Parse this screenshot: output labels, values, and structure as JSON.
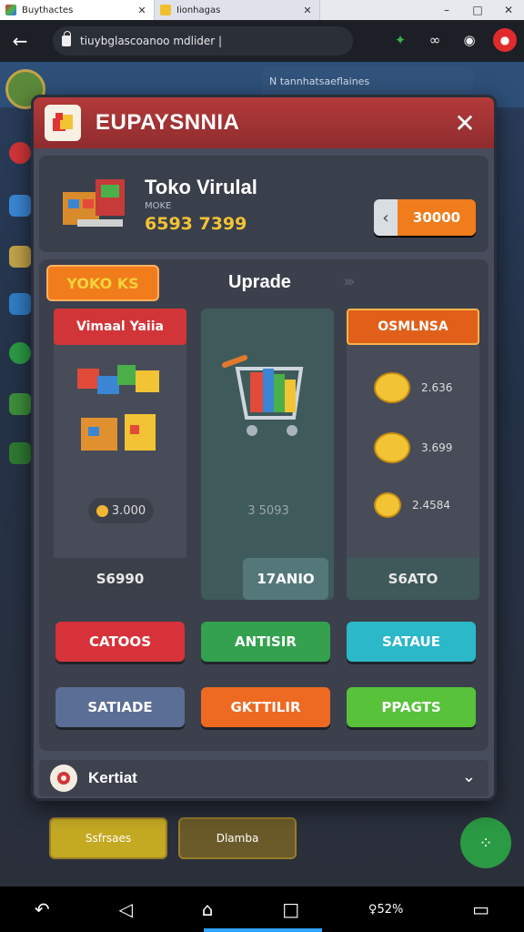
{
  "browser": {
    "active_tab": "Buythactes",
    "inactive_tab": "Iionhagas",
    "address": "tiuybglascoanoo mdlider |",
    "window_controls": [
      "–",
      "□",
      "✕"
    ]
  },
  "background": {
    "top_pill": "N tannhatsaeflaines",
    "bottom_buttons": [
      "Ssfrsaes",
      "Dlamba"
    ]
  },
  "modal": {
    "title": "EUPAYSNNIA",
    "store": {
      "name": "Toko Virulal",
      "subtitle": "MOKE",
      "number": "6593 7399",
      "price": "30000"
    },
    "panel": {
      "tag": "YOKO KS",
      "title": "Uprade",
      "columns": [
        {
          "header": "Vimaal Yaiia",
          "amount": "3.000",
          "footer": "S6990"
        },
        {
          "header": "",
          "amount": "3 5093",
          "footer": "17ANIO"
        },
        {
          "header": "OSMLNSA",
          "amount": "",
          "footer": "S6ATO",
          "coins": [
            "2.636",
            "3.699",
            "2.4584"
          ]
        }
      ],
      "buttons_row1": [
        "CATOOS",
        "ANTISIR",
        "SATAUE"
      ],
      "buttons_row2": [
        "SATIADE",
        "GKTTILIR",
        "PPAGTS"
      ]
    },
    "footer_label": "Kertiat"
  },
  "colors": {
    "header": "#a83435",
    "accent_orange": "#f07c1c",
    "btn_red": "#d7323a",
    "btn_green": "#33a14e",
    "btn_teal": "#2bb8c8",
    "btn_slate": "#5b6e96",
    "btn_orange": "#ee6a22",
    "btn_lime": "#57c23a"
  }
}
